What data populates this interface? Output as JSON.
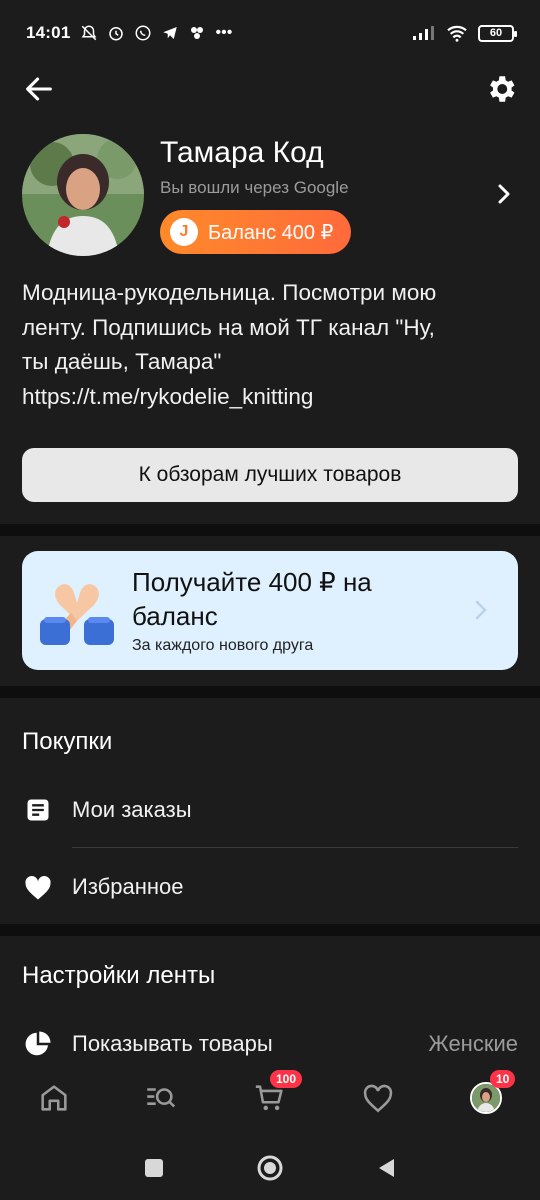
{
  "status_bar": {
    "time": "14:01",
    "battery": "60",
    "icons": [
      "bell-off-icon",
      "alarm-icon",
      "whatsapp-icon",
      "telegram-icon",
      "app-icon",
      "more-icon"
    ]
  },
  "profile": {
    "name": "Тамара Код",
    "login_note": "Вы вошли через Google",
    "balance_label": "Баланс 400 ₽",
    "coin_symbol": "J"
  },
  "bio": {
    "line1": "Модница-рукодельница.  Посмотри мою",
    "line2": "ленту.  Подпишись на мой ТГ канал \"Ну,",
    "line3": "ты даёшь, Тамара\"",
    "line4": "https://t.me/rykodelie_knitting"
  },
  "reviews_button": "К обзорам лучших товаров",
  "promo": {
    "title": "Получайте 400 ₽ на баланс",
    "subtitle": "За каждого нового друга"
  },
  "purchases": {
    "title": "Покупки",
    "items": [
      {
        "label": "Мои заказы",
        "icon": "list-icon"
      },
      {
        "label": "Избранное",
        "icon": "heart-icon"
      }
    ]
  },
  "feed_settings": {
    "title": "Настройки ленты",
    "items": [
      {
        "label": "Показывать товары",
        "value": "Женские",
        "icon": "pie-chart-icon"
      }
    ]
  },
  "bottom_nav": {
    "cart_badge": "100",
    "profile_badge": "10"
  },
  "colors": {
    "background": "#1c1c1c",
    "accent_orange": "#ff7a2a",
    "promo_bg": "#dff0ff",
    "badge_red": "#ff3347"
  }
}
